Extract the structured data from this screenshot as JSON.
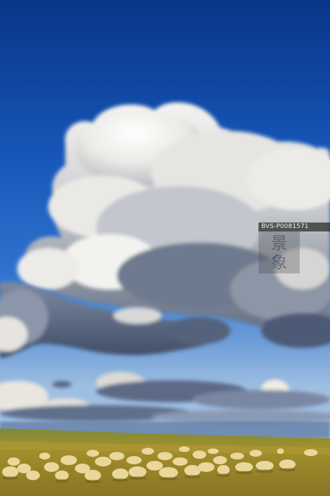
{
  "photo": {
    "subject": "flock of sheep grazing on grassland under a large cumulus cloud",
    "colors": {
      "sky_top": "#0a3a93",
      "sky_mid": "#1f63c6",
      "sky_horizon": "#8fb4e0",
      "cloud_light": "#f4f4f2",
      "cloud_shadow": "#6f7b8f",
      "grass": "#9a8a2e",
      "sheep": "#e9d59a"
    }
  },
  "watermark": {
    "code": "BVS-P0081571",
    "logo_text": "景象"
  }
}
